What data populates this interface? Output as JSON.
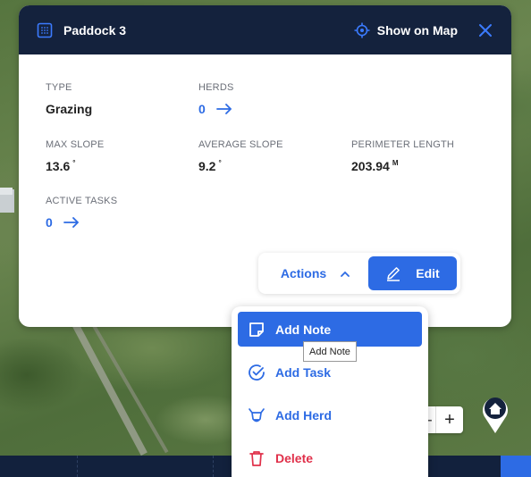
{
  "header": {
    "title": "Paddock 3",
    "show_on_map_label": "Show on Map"
  },
  "fields": {
    "type": {
      "label": "TYPE",
      "value": "Grazing"
    },
    "herds": {
      "label": "HERDS",
      "value": "0"
    },
    "max_slope": {
      "label": "MAX SLOPE",
      "value": "13.6",
      "unit": "°"
    },
    "average_slope": {
      "label": "AVERAGE SLOPE",
      "value": "9.2",
      "unit": "°"
    },
    "perimeter_length": {
      "label": "PERIMETER LENGTH",
      "value": "203.94",
      "unit": "M"
    },
    "active_tasks": {
      "label": "ACTIVE TASKS",
      "value": "0"
    }
  },
  "actions": {
    "actions_label": "Actions",
    "edit_label": "Edit"
  },
  "menu": {
    "items": [
      {
        "label": "Add Note",
        "icon": "note-icon",
        "state": "hovered"
      },
      {
        "label": "Add Task",
        "icon": "check-circle-icon"
      },
      {
        "label": "Add Herd",
        "icon": "cow-head-icon"
      },
      {
        "label": "Delete",
        "icon": "trash-icon",
        "style": "danger"
      }
    ],
    "tooltip": "Add Note"
  },
  "map_controls": {
    "zoom_in": "+",
    "zoom_out": "-"
  },
  "colors": {
    "header_bg": "#14223d",
    "accent": "#2d6be4",
    "danger": "#e0304a"
  }
}
